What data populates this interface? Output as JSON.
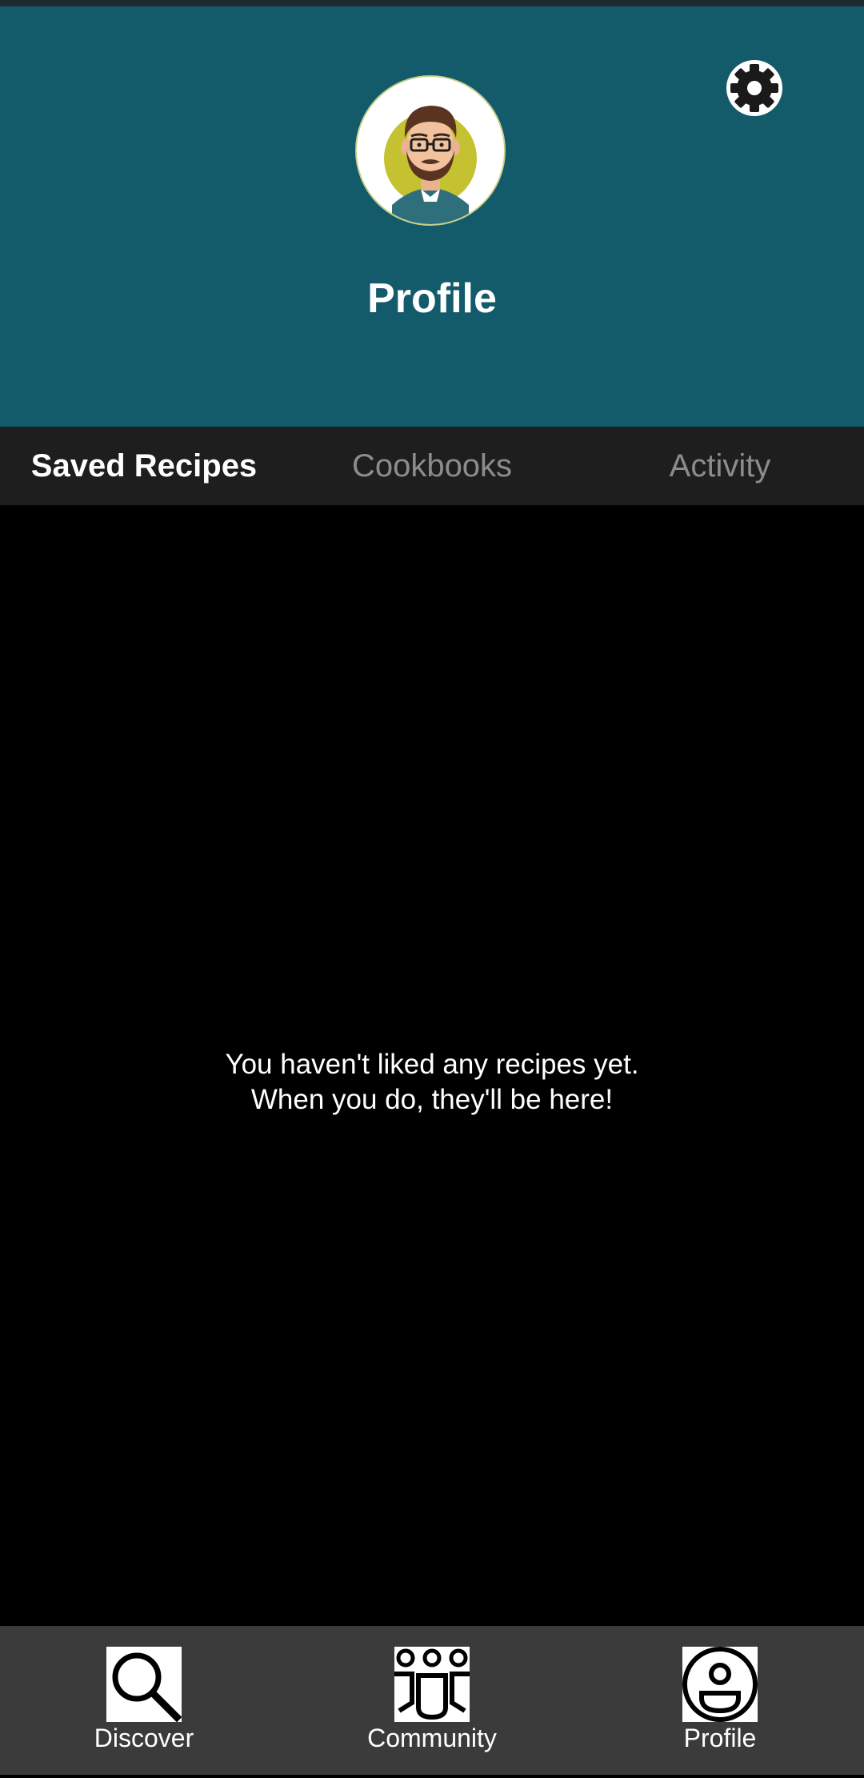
{
  "header": {
    "title": "Profile",
    "background_color": "#135a6b",
    "avatar_icon": "user-avatar",
    "settings_icon": "gear-icon"
  },
  "tabs": [
    {
      "label": "Saved Recipes",
      "active": true
    },
    {
      "label": "Cookbooks",
      "active": false
    },
    {
      "label": "Activity",
      "active": false
    }
  ],
  "empty_state": {
    "line1": "You haven't liked any recipes yet.",
    "line2": "When you do, they'll be here!"
  },
  "bottom_nav": {
    "items": [
      {
        "label": "Discover",
        "icon": "search-icon"
      },
      {
        "label": "Community",
        "icon": "community-icon"
      },
      {
        "label": "Profile",
        "icon": "profile-icon"
      }
    ]
  }
}
